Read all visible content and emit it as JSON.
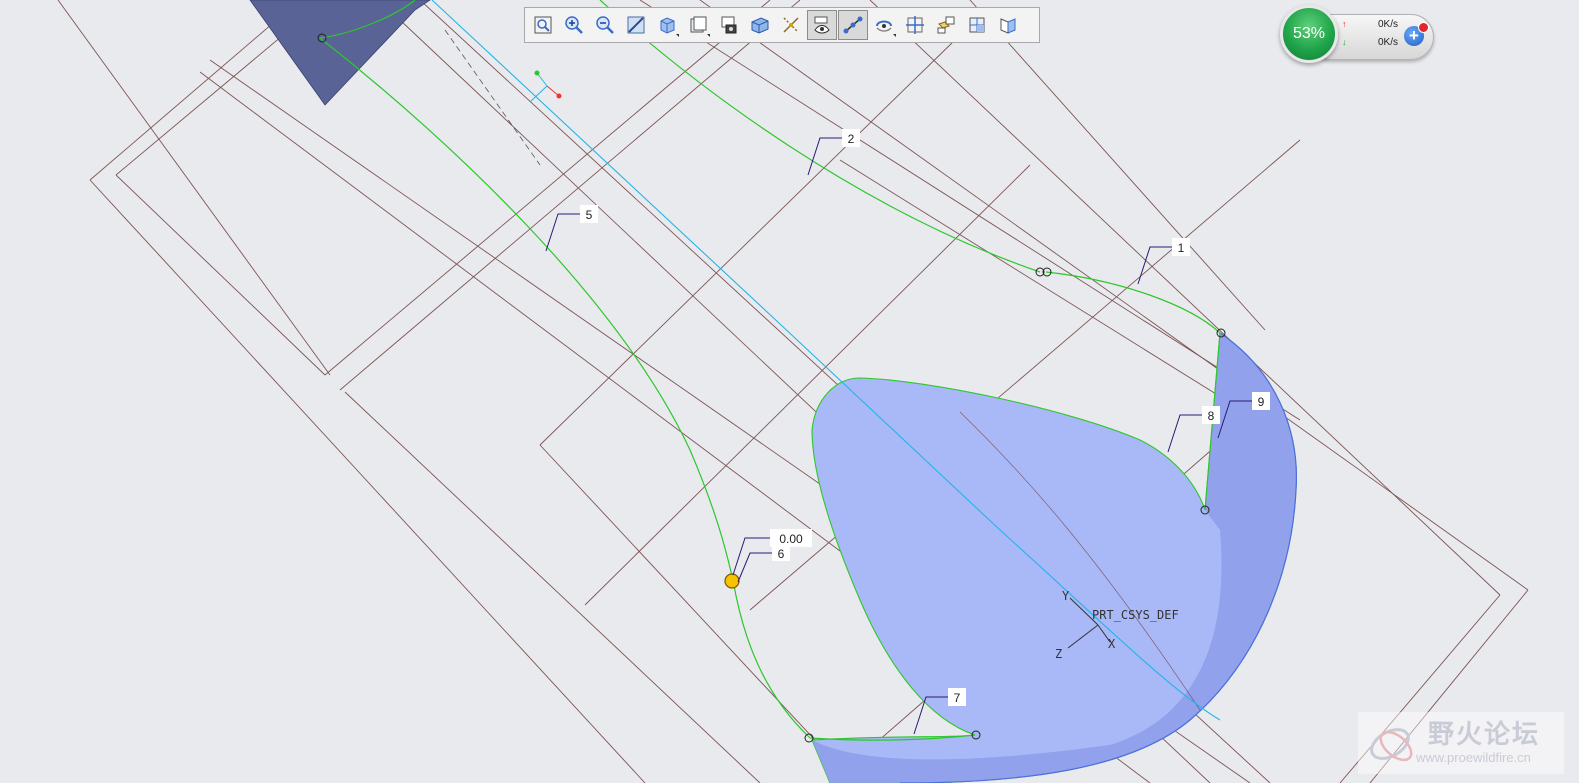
{
  "toolbar": {
    "buttons": [
      {
        "name": "refit-button",
        "icon": "refit-icon"
      },
      {
        "name": "zoom-in-button",
        "icon": "zoom-in-icon"
      },
      {
        "name": "zoom-out-button",
        "icon": "zoom-out-icon"
      },
      {
        "name": "repaint-button",
        "icon": "repaint-icon"
      },
      {
        "name": "display-style-button",
        "icon": "shaded-cube-icon"
      },
      {
        "name": "saved-views-button",
        "icon": "saved-views-icon"
      },
      {
        "name": "view-manager-button",
        "icon": "view-manager-icon"
      },
      {
        "name": "perspective-view-button",
        "icon": "perspective-icon"
      },
      {
        "name": "datum-display-button",
        "icon": "datum-display-icon"
      },
      {
        "name": "annotation-display-button",
        "icon": "annotation-display-icon"
      },
      {
        "name": "spin-center-button",
        "icon": "spin-center-icon"
      },
      {
        "name": "orient-mode-button",
        "icon": "orient-mode-icon"
      },
      {
        "name": "datum-planes-button",
        "icon": "datum-planes-icon"
      },
      {
        "name": "datum-axes-button",
        "icon": "datum-axes-icon"
      },
      {
        "name": "datum-points-button",
        "icon": "datum-points-icon"
      },
      {
        "name": "coordinate-systems-button",
        "icon": "csys-icon"
      }
    ]
  },
  "net_widget": {
    "percent": "53%",
    "upload": "0K/s",
    "download": "0K/s",
    "add_label": "+"
  },
  "callouts": {
    "l1": "1",
    "l2": "2",
    "l5": "5",
    "l6": "6",
    "l7": "7",
    "l8": "8",
    "l9": "9",
    "dim": "0.00"
  },
  "csys": {
    "name": "PRT_CSYS_DEF",
    "x": "X",
    "y": "Y",
    "z": "Z"
  },
  "watermark": {
    "title": "野火论坛",
    "url": "www.proewildfire.cn"
  },
  "colors": {
    "background": "#e9eaed",
    "datum": "#6b3a3a",
    "curve": "#2dc72d",
    "surface": "#a9b8f7",
    "surface_edge": "#4f6de0",
    "dark_surface": "#5a6395",
    "cyan_edge": "#24b5e8",
    "callout": "#2b1a72",
    "vertex": "#f7c200"
  }
}
